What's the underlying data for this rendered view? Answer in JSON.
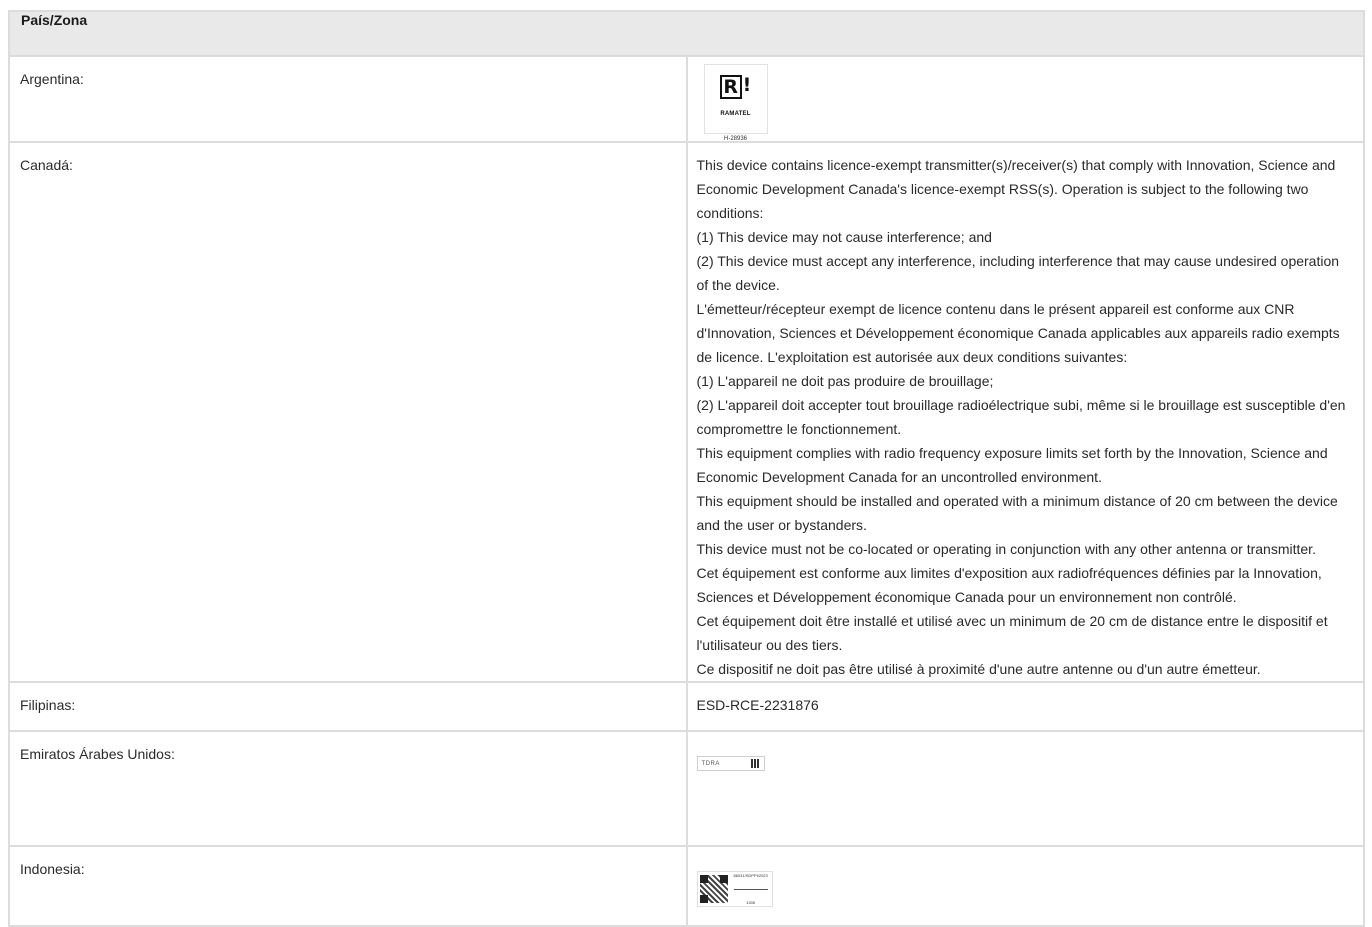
{
  "header": {
    "title": "País/Zona"
  },
  "rows": {
    "argentina": {
      "country": "Argentina:",
      "logo": {
        "letter": "R",
        "mark": "!",
        "name": "RAMATEL",
        "code": "H-28936"
      }
    },
    "canada": {
      "country": "Canadá:",
      "paragraphs": [
        "This device contains licence-exempt transmitter(s)/receiver(s) that comply with Innovation, Science and Economic Development Canada's licence-exempt RSS(s). Operation is subject to the following two conditions:",
        "(1) This device may not cause interference; and",
        "(2) This device must accept any interference, including interference that may cause undesired operation of the device.",
        "L'émetteur/récepteur exempt de licence contenu dans le présent appareil est conforme aux CNR d'Innovation, Sciences et Développement économique Canada applicables aux appareils radio exempts de licence. L'exploitation est autorisée aux deux conditions suivantes:",
        "(1) L'appareil ne doit pas produire de brouillage;",
        "(2) L'appareil doit accepter tout brouillage radioélectrique subi, même si le brouillage est susceptible d'en compromettre le fonctionnement.",
        "This equipment complies with radio frequency exposure limits set forth by the Innovation, Science and Economic Development Canada for an uncontrolled environment.",
        "This equipment should be installed and operated with a minimum distance of 20 cm between the device and the user or bystanders.",
        "This device must not be co-located or operating in conjunction with any other antenna or transmitter.",
        "Cet équipement est conforme aux limites d'exposition aux radiofréquences définies par la Innovation, Sciences et Développement économique Canada pour un environnement non contrôlé.",
        "Cet équipement doit être installé et utilisé avec un minimum de 20 cm de distance entre le dispositif et l'utilisateur ou des tiers.",
        "Ce dispositif ne doit pas être utilisé à proximité d'une autre antenne ou d'un autre émetteur."
      ]
    },
    "philippines": {
      "country": "Filipinas:",
      "value": "ESD-RCE-2231876"
    },
    "uae": {
      "country": "Emiratos Árabes Unidos:",
      "logo": {
        "text": "TDRA"
      }
    },
    "indonesia": {
      "country": "Indonesia:",
      "logo": {
        "top": "86031/SDPPI/2023",
        "bottom": "1306"
      }
    }
  }
}
